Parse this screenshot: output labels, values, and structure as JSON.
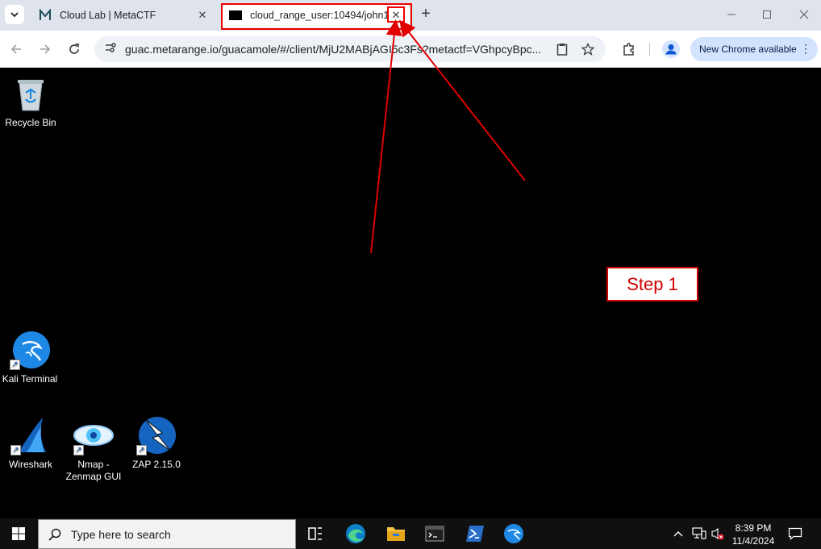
{
  "browser": {
    "tabs": [
      {
        "title": "Cloud Lab | MetaCTF",
        "favicon": "metactf-icon",
        "active": false
      },
      {
        "title": "cloud_range_user:10494/john1_",
        "favicon": "guacamole-terminal-icon",
        "active": true
      }
    ],
    "new_tab_label": "+",
    "url": "guac.metarange.io/guacamole/#/client/MjU2MABjAGI5c3Fs?metactf=VGhpcyBpc...",
    "update_button_label": "New Chrome available"
  },
  "desktop": {
    "icons": [
      {
        "label": "Recycle Bin",
        "icon": "recycle-bin-icon"
      },
      {
        "label": "Kali Terminal",
        "icon": "kali-icon"
      },
      {
        "label": "Wireshark",
        "icon": "wireshark-icon"
      },
      {
        "label": "Nmap - Zenmap GUI",
        "icon": "zenmap-icon"
      },
      {
        "label": "ZAP 2.15.0",
        "icon": "zap-icon"
      }
    ]
  },
  "annotation": {
    "step_label": "Step 1",
    "color": "#e00000"
  },
  "taskbar": {
    "search_placeholder": "Type here to search",
    "apps": [
      "task-view-icon",
      "edge-icon",
      "file-explorer-icon",
      "terminal-icon",
      "powershell-icon",
      "kali-icon"
    ],
    "time": "8:39 PM",
    "date": "11/4/2024"
  }
}
